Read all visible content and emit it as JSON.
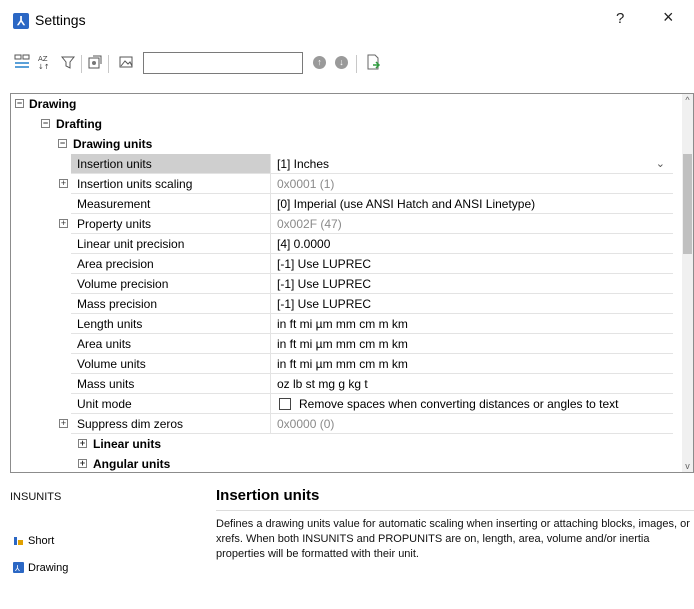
{
  "window": {
    "title": "Settings",
    "help": "?",
    "close": "×"
  },
  "toolbar": {
    "search_value": "",
    "icons": [
      "categorized-view-icon",
      "sort-az-icon",
      "filter-icon",
      "export-icon",
      "prev-icon",
      "next-icon",
      "open-file-icon"
    ]
  },
  "tree": {
    "drawing": "Drawing",
    "drafting": "Drafting",
    "drawing_units": "Drawing units",
    "linear_units": "Linear units",
    "angular_units": "Angular units"
  },
  "properties": [
    {
      "name": "Insertion units",
      "value": "[1] Inches",
      "selected": true,
      "dropdown": true
    },
    {
      "name": "Insertion units scaling",
      "value": "0x0001 (1)",
      "gray": true,
      "expandable": true
    },
    {
      "name": "Measurement",
      "value": "[0] Imperial (use ANSI Hatch and ANSI Linetype)"
    },
    {
      "name": "Property units",
      "value": "0x002F (47)",
      "gray": true,
      "expandable": true
    },
    {
      "name": "Linear unit precision",
      "value": "[4] 0.0000"
    },
    {
      "name": "Area precision",
      "value": "[-1] Use LUPREC"
    },
    {
      "name": "Volume precision",
      "value": "[-1] Use LUPREC"
    },
    {
      "name": "Mass precision",
      "value": "[-1] Use LUPREC"
    },
    {
      "name": "Length units",
      "value": "in ft mi µm mm cm m km"
    },
    {
      "name": "Area units",
      "value": "in ft mi µm mm cm m km"
    },
    {
      "name": "Volume units",
      "value": "in ft mi µm mm cm m km"
    },
    {
      "name": "Mass units",
      "value": "oz lb st mg g kg t"
    },
    {
      "name": "Unit mode",
      "value": "Remove spaces when converting distances or angles to text",
      "checkbox": true
    },
    {
      "name": "Suppress dim zeros",
      "value": "0x0000 (0)",
      "gray": true,
      "expandable": true
    }
  ],
  "details": {
    "variable": "INSUNITS",
    "type": "Short",
    "scope": "Drawing",
    "title": "Insertion units",
    "description": "Defines a drawing units value for automatic scaling when inserting or attaching blocks, images, or xrefs. When both INSUNITS and PROPUNITS are on, length, area, volume and/or inertia properties will be formatted with their unit."
  },
  "colors": {
    "accent": "#2b67c4",
    "selected_row": "#cfcfcf"
  }
}
